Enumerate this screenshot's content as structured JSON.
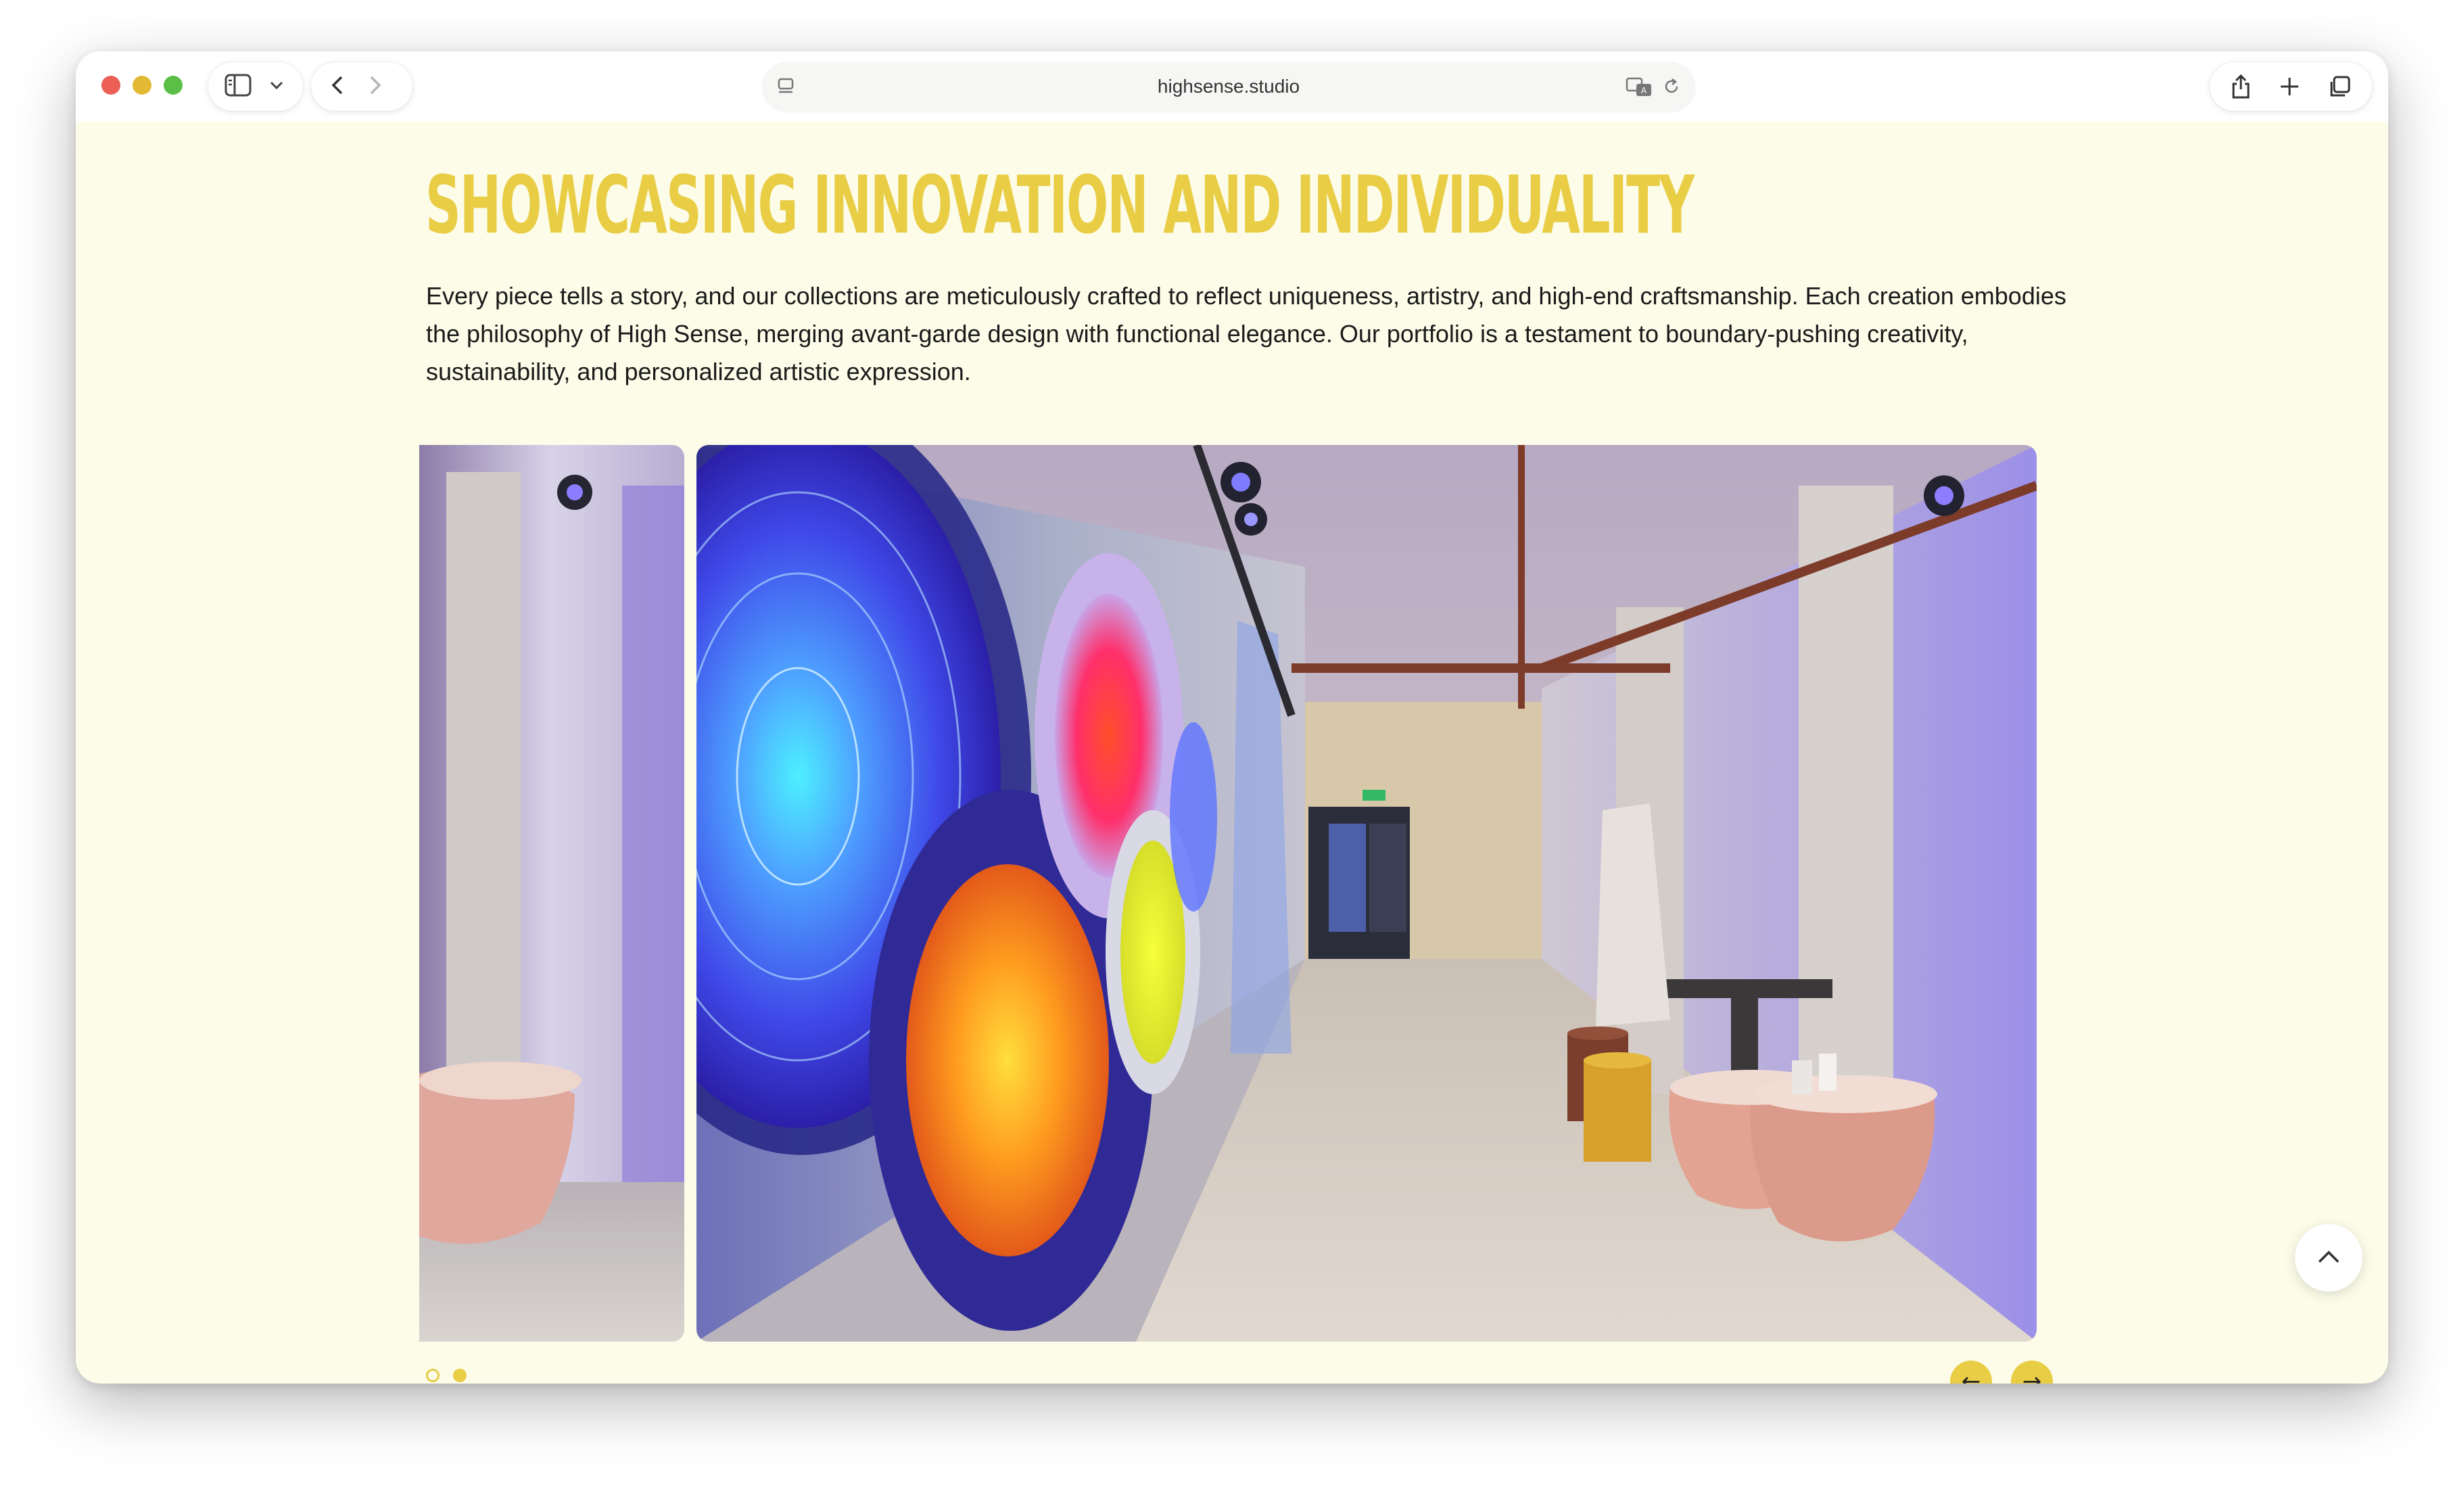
{
  "browser": {
    "url": "highsense.studio",
    "icons": {
      "sidebar": "sidebar-icon",
      "dropdown": "chevron-down-icon",
      "back": "chevron-left-icon",
      "forward": "chevron-right-icon",
      "page_menu": "page-menu-icon",
      "translate": "translate-icon",
      "reload": "reload-icon",
      "share": "share-icon",
      "new_tab": "plus-icon",
      "tabs": "tabs-overview-icon"
    }
  },
  "section": {
    "headline": "SHOWCASING INNOVATION AND INDIVIDUALITY",
    "intro": "Every piece tells a story, and our collections are meticulously crafted to reflect uniqueness, artistry, and high-end craftsmanship. Each creation embodies the philosophy of High Sense, merging avant-garde design with functional elegance. Our portfolio is a testament to boundary-pushing creativity, sustainability, and personalized artistic expression."
  },
  "carousel": {
    "prev_label": "←",
    "next_label": "→",
    "active_slide": 2,
    "slide_count": 2
  },
  "colors": {
    "accent": "#e8cd45",
    "page_background": "#fcfce9",
    "text": "#1a1a1a"
  }
}
